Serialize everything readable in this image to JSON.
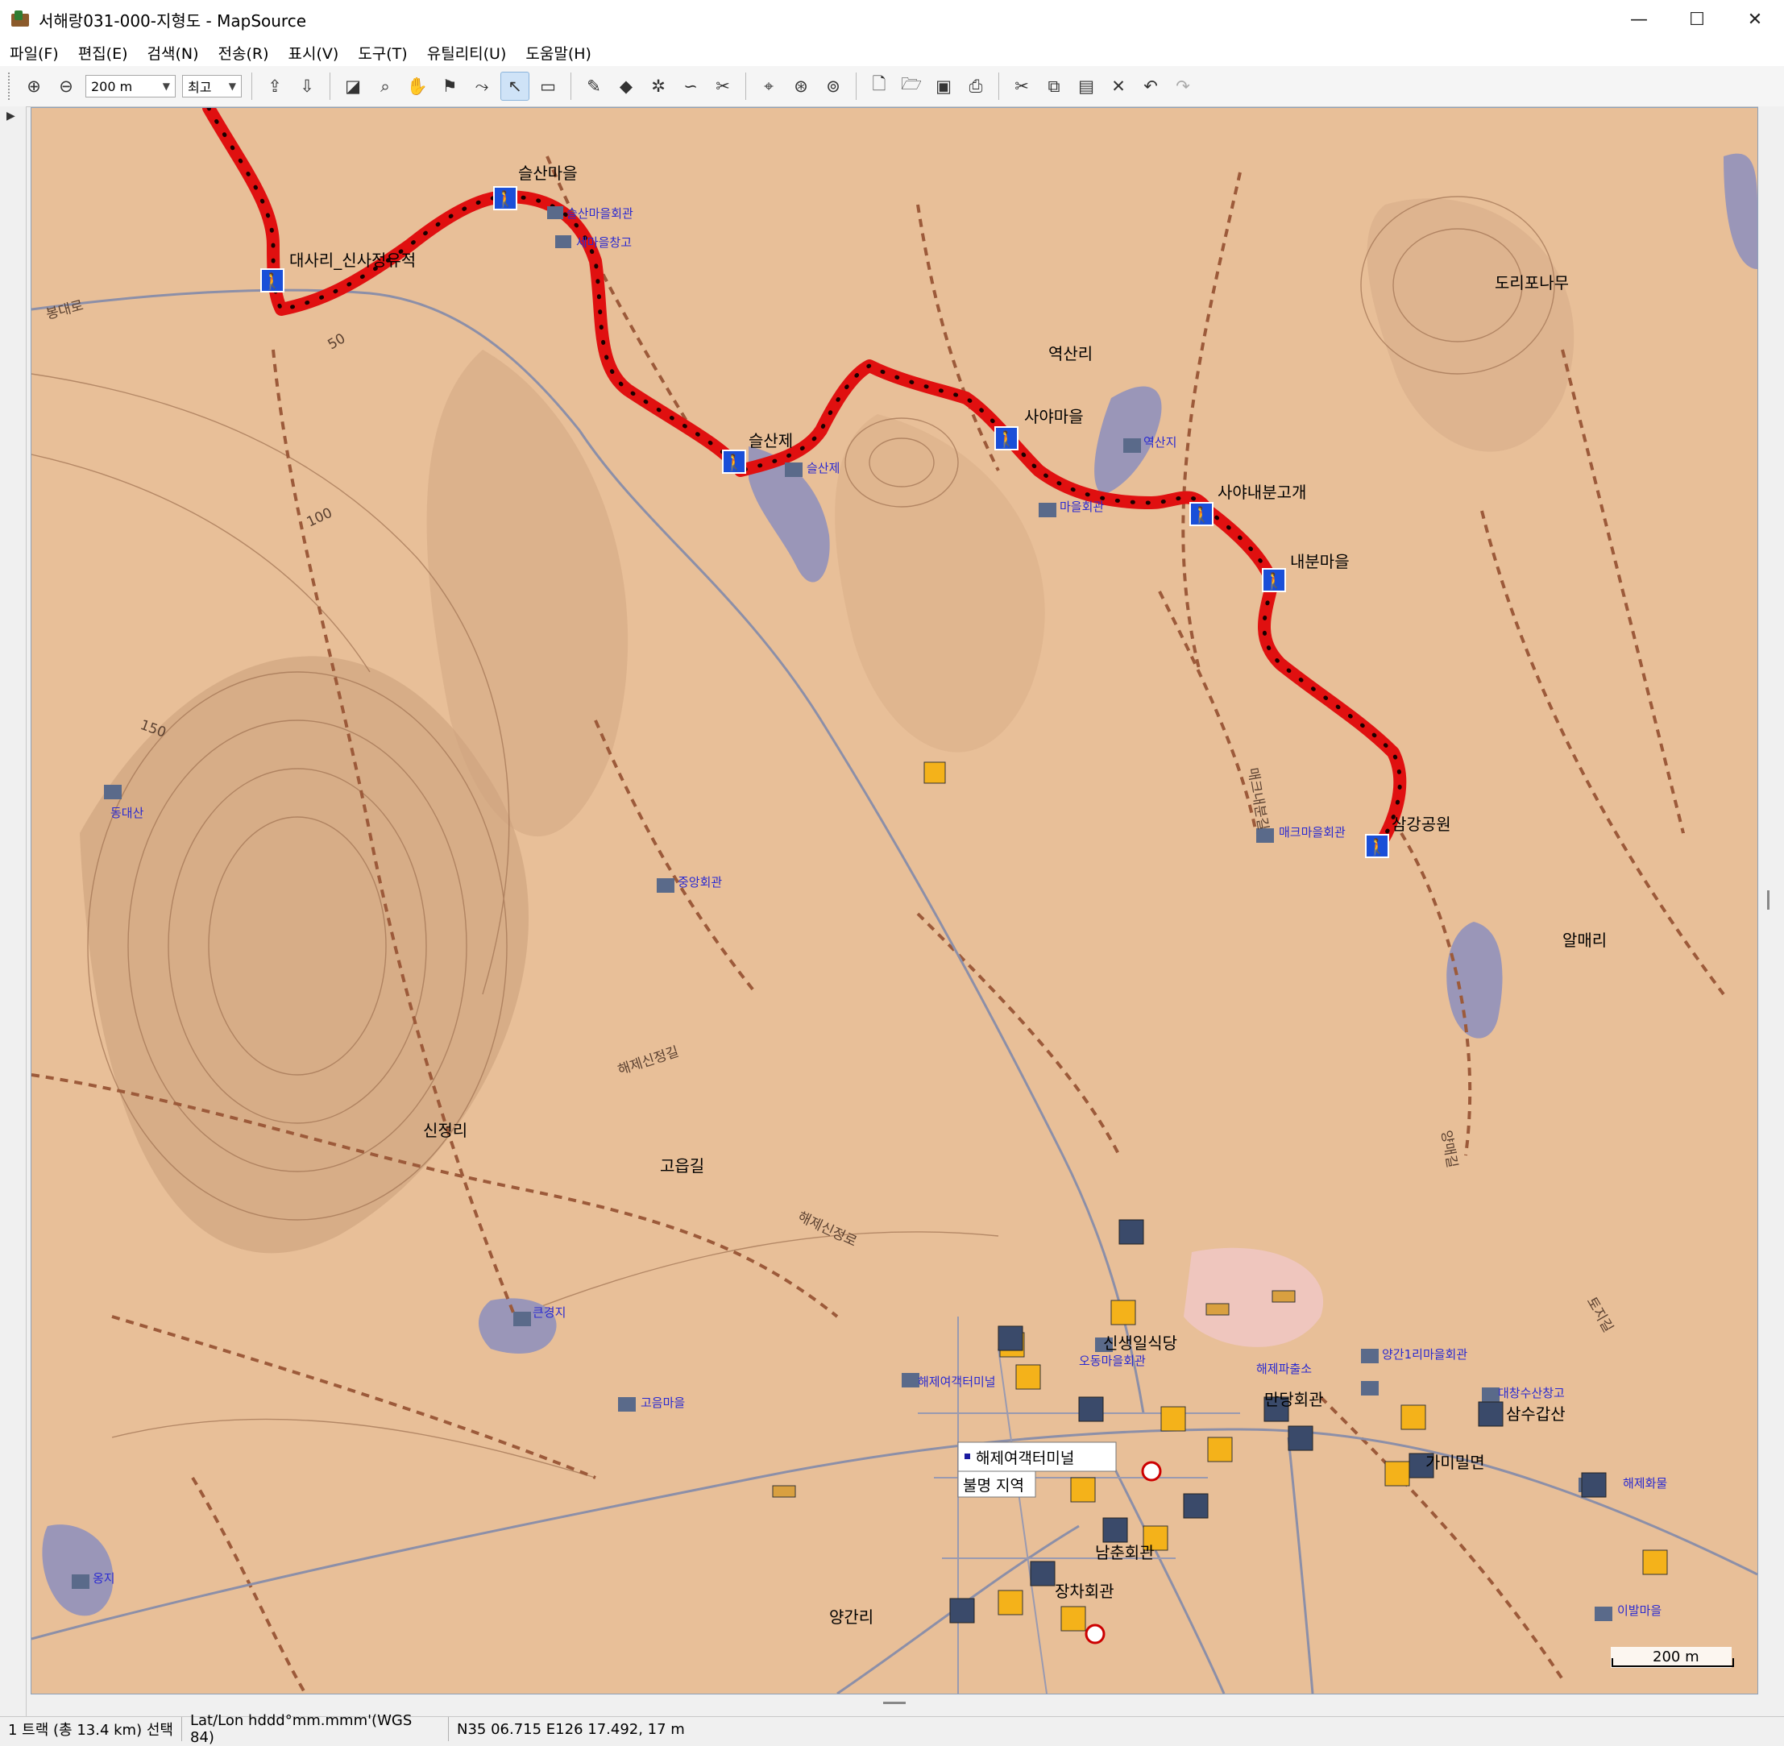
{
  "window": {
    "title": "서해랑031-000-지형도 - MapSource",
    "controls": [
      "—",
      "☐",
      "✕"
    ]
  },
  "menu": [
    "파일(F)",
    "편집(E)",
    "검색(N)",
    "전송(R)",
    "표시(V)",
    "도구(T)",
    "유틸리티(U)",
    "도움말(H)"
  ],
  "toolbar": {
    "zoom_value": "200 m",
    "detail_value": "최고"
  },
  "map": {
    "scale_label": "200 m",
    "waypoints": [
      {
        "label": "대사리_신사정유적"
      },
      {
        "label": "슬산마을"
      },
      {
        "label": "슬산제"
      },
      {
        "label": "사야마을"
      },
      {
        "label": "사야내분고개"
      },
      {
        "label": "내분마을"
      },
      {
        "label": "삼강공원"
      }
    ],
    "pois": [
      "슬산마을회관",
      "세마을창고",
      "슬산제",
      "역산지",
      "마을회관",
      "매크마을회관",
      "중앙회관",
      "동대산",
      "고음마을",
      "큰경지",
      "옹지",
      "해제여객터미널",
      "오동마을회관",
      "양간1리마을회관",
      "대창수산창고",
      "해제파출소",
      "해제화물",
      "이발마을"
    ],
    "places": [
      "역산리",
      "신정리",
      "알매리",
      "도리포나무",
      "양간리"
    ],
    "roads": [
      "봉대로",
      "해제신정길",
      "고읍길",
      "매크내분길",
      "해제신정로",
      "토지길",
      "양매길"
    ],
    "contours": [
      "50",
      "100",
      "150"
    ],
    "town_labels": [
      "신생일식당",
      "만당회관",
      "삼수갑산",
      "가미밀면",
      "남춘회관",
      "장차회관"
    ],
    "popup": {
      "title": "해제여객터미널",
      "subtitle": "불명 지역"
    }
  },
  "status": {
    "selection": "1 트랙 (총 13.4 km) 선택",
    "format": "Lat/Lon hddd°mm.mmm'(WGS 84)",
    "position": "N35 06.715 E126 17.492, 17 m"
  }
}
